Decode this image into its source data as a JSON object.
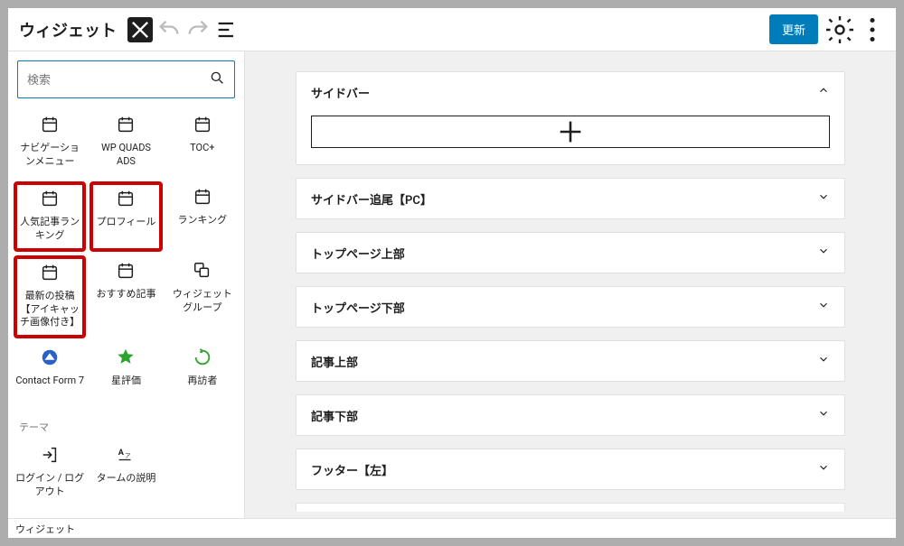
{
  "header": {
    "title": "ウィジェット",
    "update_button": "更新"
  },
  "sidebar": {
    "search_placeholder": "検索",
    "blocks_row1": [
      {
        "label": "ナビゲーションメニュー",
        "hl": false
      },
      {
        "label": "WP QUADS ADS",
        "hl": false
      },
      {
        "label": "TOC+",
        "hl": false
      }
    ],
    "blocks_row2": [
      {
        "label": "人気記事ランキング",
        "hl": true
      },
      {
        "label": "プロフィール",
        "hl": true
      },
      {
        "label": "ランキング",
        "hl": false
      }
    ],
    "blocks_row3": [
      {
        "label": "最新の投稿【アイキャッチ画像付き】",
        "hl": true
      },
      {
        "label": "おすすめ記事",
        "hl": false
      },
      {
        "label": "ウィジェットグループ",
        "hl": false
      }
    ],
    "blocks_row4": [
      {
        "label": "Contact Form 7",
        "icon": "cf7"
      },
      {
        "label": "星評価",
        "icon": "star"
      },
      {
        "label": "再訪者",
        "icon": "revisit"
      }
    ],
    "section_label": "テーマ",
    "blocks_row5": [
      {
        "label": "ログイン / ログアウト",
        "icon": "login"
      },
      {
        "label": "タームの説明",
        "icon": "term"
      }
    ]
  },
  "areas": [
    {
      "title": "サイドバー",
      "expanded": true
    },
    {
      "title": "サイドバー追尾【PC】",
      "expanded": false
    },
    {
      "title": "トップページ上部",
      "expanded": false
    },
    {
      "title": "トップページ下部",
      "expanded": false
    },
    {
      "title": "記事上部",
      "expanded": false
    },
    {
      "title": "記事下部",
      "expanded": false
    },
    {
      "title": "フッター【左】",
      "expanded": false
    }
  ],
  "breadcrumb": "ウィジェット"
}
